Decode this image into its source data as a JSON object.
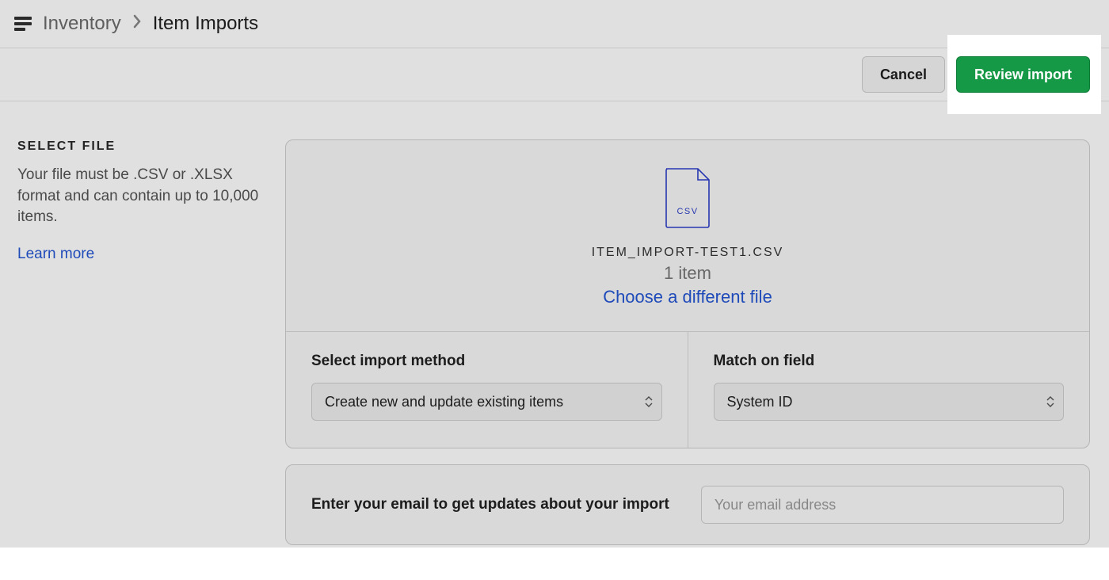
{
  "breadcrumb": {
    "root": "Inventory",
    "current": "Item Imports"
  },
  "actions": {
    "cancel": "Cancel",
    "review": "Review import"
  },
  "side": {
    "heading": "SELECT FILE",
    "description": "Your file must be .CSV or .XLSX format and can contain up to 10,000 items.",
    "learn_more": "Learn more"
  },
  "file": {
    "icon_badge": "CSV",
    "name": "ITEM_IMPORT-TEST1.CSV",
    "count_text": "1 item",
    "choose_label": "Choose a different file"
  },
  "method": {
    "label": "Select import method",
    "selected": "Create new and update existing items"
  },
  "match": {
    "label": "Match on field",
    "selected": "System ID"
  },
  "email": {
    "label": "Enter your email to get updates about your import",
    "placeholder": "Your email address",
    "value": ""
  }
}
